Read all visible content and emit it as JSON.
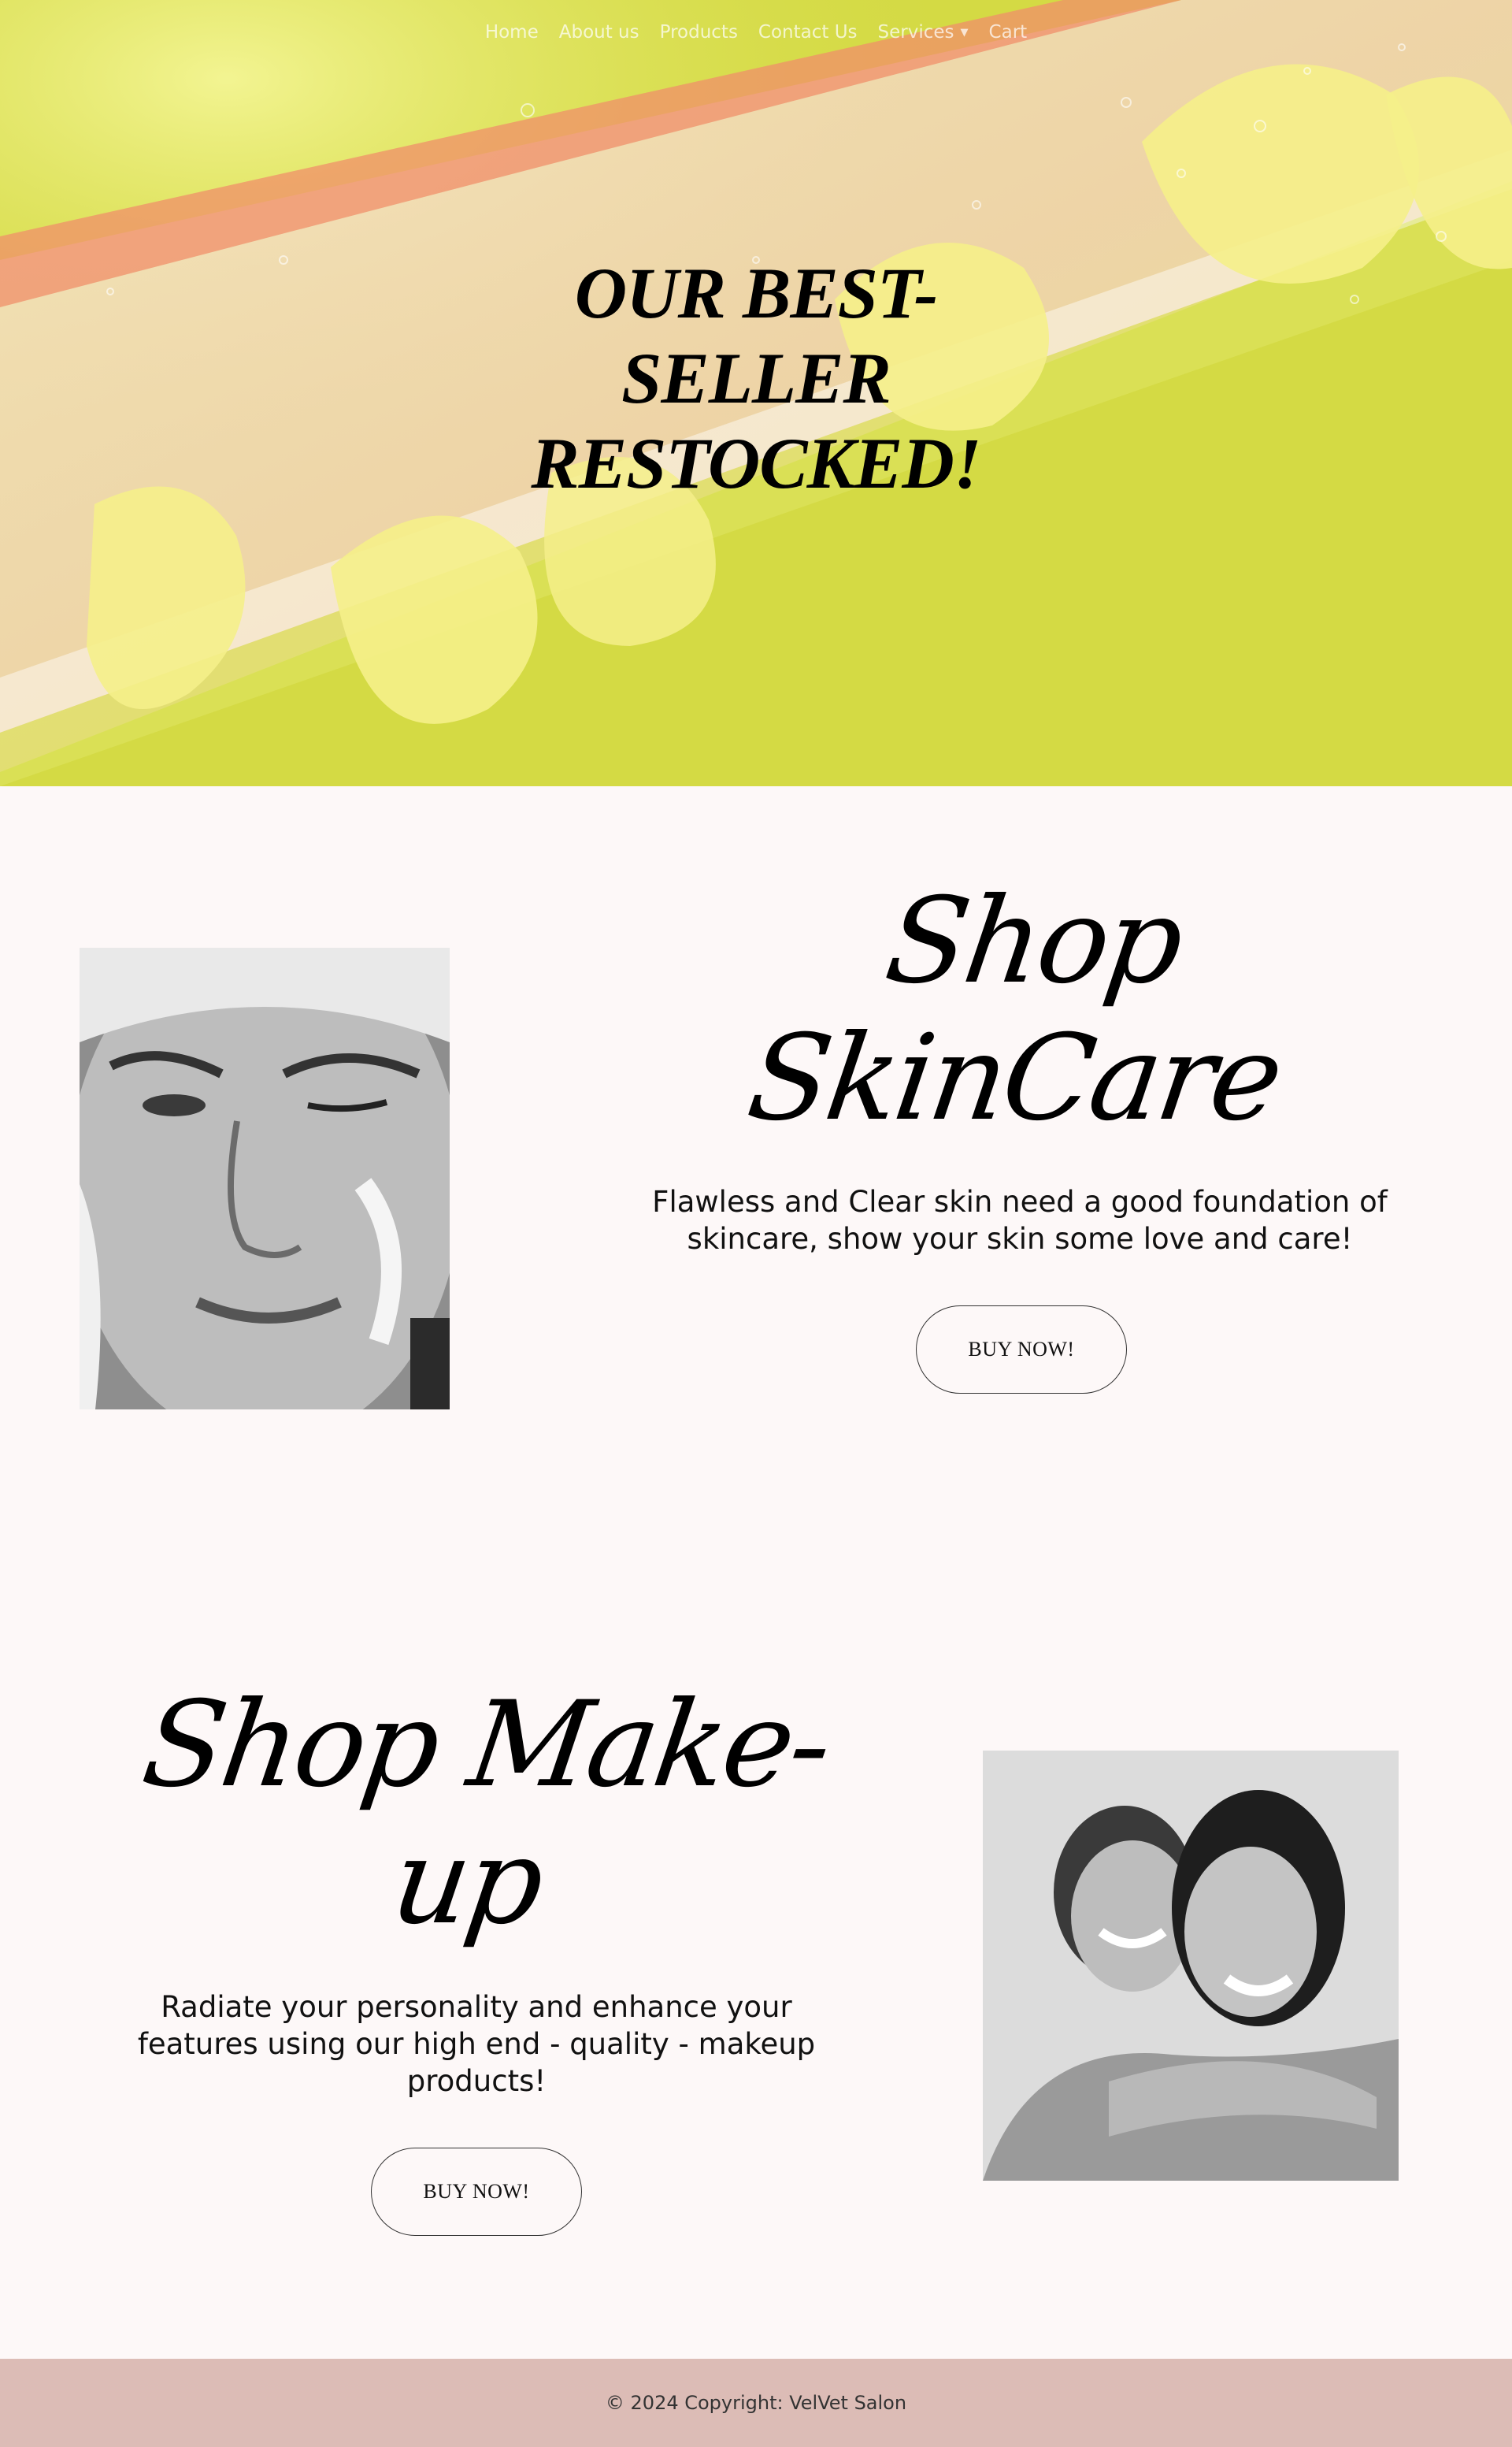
{
  "nav": {
    "items": [
      {
        "label": "Home"
      },
      {
        "label": "About us"
      },
      {
        "label": "Products"
      },
      {
        "label": "Contact Us"
      },
      {
        "label": "Services"
      },
      {
        "label": "Cart"
      }
    ]
  },
  "hero": {
    "title_lines": [
      "OUR BEST-",
      "SELLER",
      "RESTOCKED!"
    ],
    "bg_color": "#d7dc4a"
  },
  "skincare": {
    "heading": "Shop SkinCare",
    "text": "Flawless and Clear skin need a good foundation of skincare, show your skin some love and care!",
    "button": "BUY NOW!"
  },
  "makeup": {
    "heading": "Shop Make-up",
    "text": "Radiate your personality and enhance your features using our high end - quality - makeup products!",
    "button": "BUY NOW!"
  },
  "footer": {
    "text": "© 2024 Copyright: VelVet Salon",
    "bg_color": "#dcbcb6"
  }
}
